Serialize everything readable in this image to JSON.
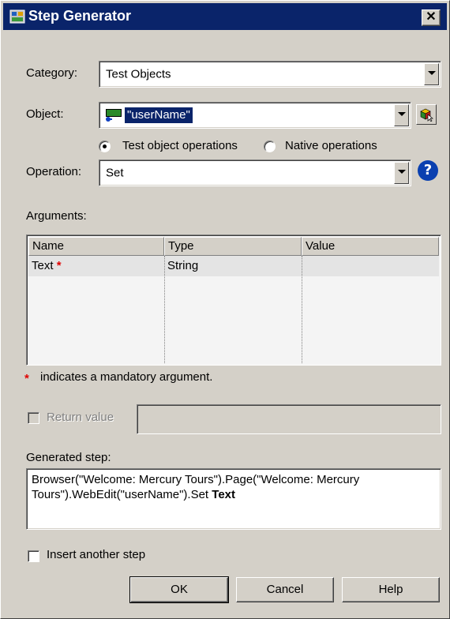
{
  "window": {
    "title": "Step Generator",
    "close_label": "✕"
  },
  "category": {
    "label": "Category:",
    "value": "Test Objects"
  },
  "object": {
    "label": "Object:",
    "value": "\"userName\""
  },
  "operation_mode": {
    "test_object_label": "Test object operations",
    "native_label": "Native operations",
    "selected": "test_object"
  },
  "operation": {
    "label": "Operation:",
    "value": "Set"
  },
  "arguments": {
    "label": "Arguments:",
    "columns": [
      "Name",
      "Type",
      "Value"
    ],
    "rows": [
      {
        "name": "Text",
        "required_mark": "*",
        "type": "String",
        "value": ""
      }
    ],
    "footnote_mark": "*",
    "footnote": "indicates a mandatory argument."
  },
  "return_value": {
    "label": "Return value",
    "value": "",
    "checked": false
  },
  "generated_step": {
    "label": "Generated step:",
    "line1": "Browser(\"Welcome: Mercury Tours\").Page(\"Welcome: Mercury",
    "line2_prefix": "Tours\").WebEdit(\"userName\").Set ",
    "line2_bold": "Text"
  },
  "insert_another": {
    "label": "Insert another step",
    "checked": false
  },
  "buttons": {
    "ok": "OK",
    "cancel": "Cancel",
    "help": "Help"
  },
  "icons": {
    "title": "step-generator-icon",
    "object": "webedit-icon",
    "object_picker": "object-picker-icon",
    "help": "help-icon"
  }
}
